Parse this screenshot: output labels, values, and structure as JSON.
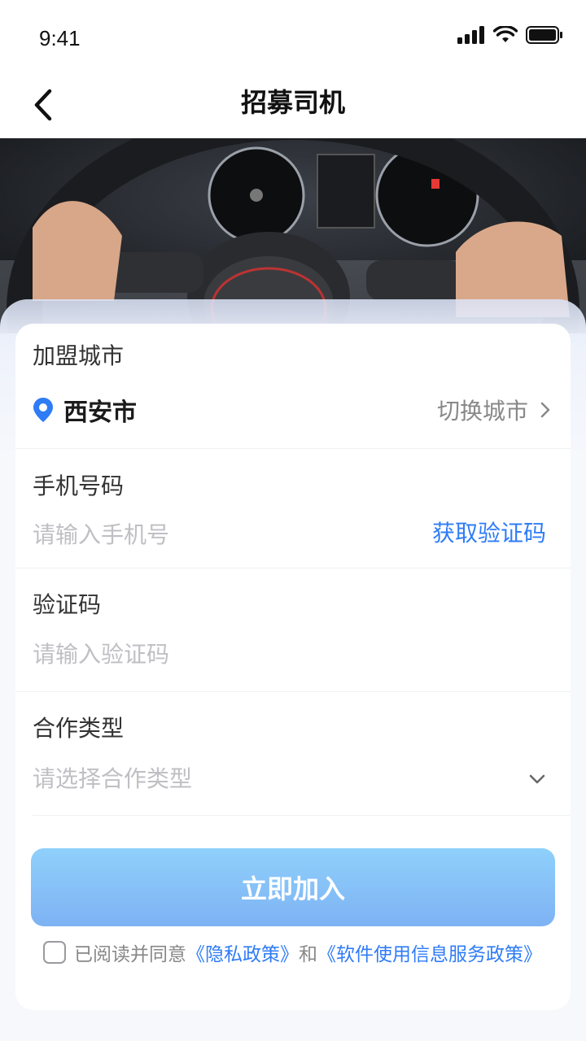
{
  "status": {
    "time": "9:41"
  },
  "nav": {
    "title": "招募司机"
  },
  "form": {
    "city": {
      "label": "加盟城市",
      "value": "西安市",
      "switch_label": "切换城市"
    },
    "phone": {
      "label": "手机号码",
      "placeholder": "请输入手机号",
      "get_code": "获取验证码"
    },
    "code": {
      "label": "验证码",
      "placeholder": "请输入验证码"
    },
    "coop": {
      "label": "合作类型",
      "placeholder": "请选择合作类型"
    }
  },
  "join_button": "立即加入",
  "agreement": {
    "prefix": "已阅读并同意",
    "privacy": "《隐私政策》",
    "conj": "和",
    "service": "《软件使用信息服务政策》"
  },
  "colors": {
    "accent": "#2f7cf6",
    "button_start": "#8fd0fb",
    "button_end": "#7eb2f4"
  }
}
